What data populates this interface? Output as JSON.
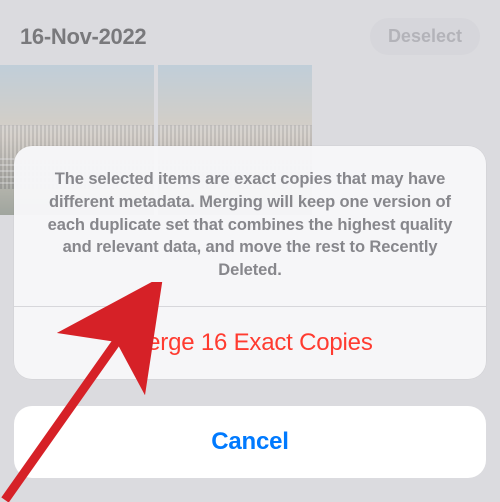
{
  "header": {
    "date": "16-Nov-2022",
    "deselect_label": "Deselect"
  },
  "sheet": {
    "message": "The selected items are exact copies that may have different metadata. Merging will keep one version of each duplicate set that combines the highest quality and relevant data, and move the rest to Recently Deleted.",
    "merge_label": "Merge 16 Exact Copies",
    "cancel_label": "Cancel"
  },
  "annotation": {
    "arrow_color": "#d62127"
  }
}
